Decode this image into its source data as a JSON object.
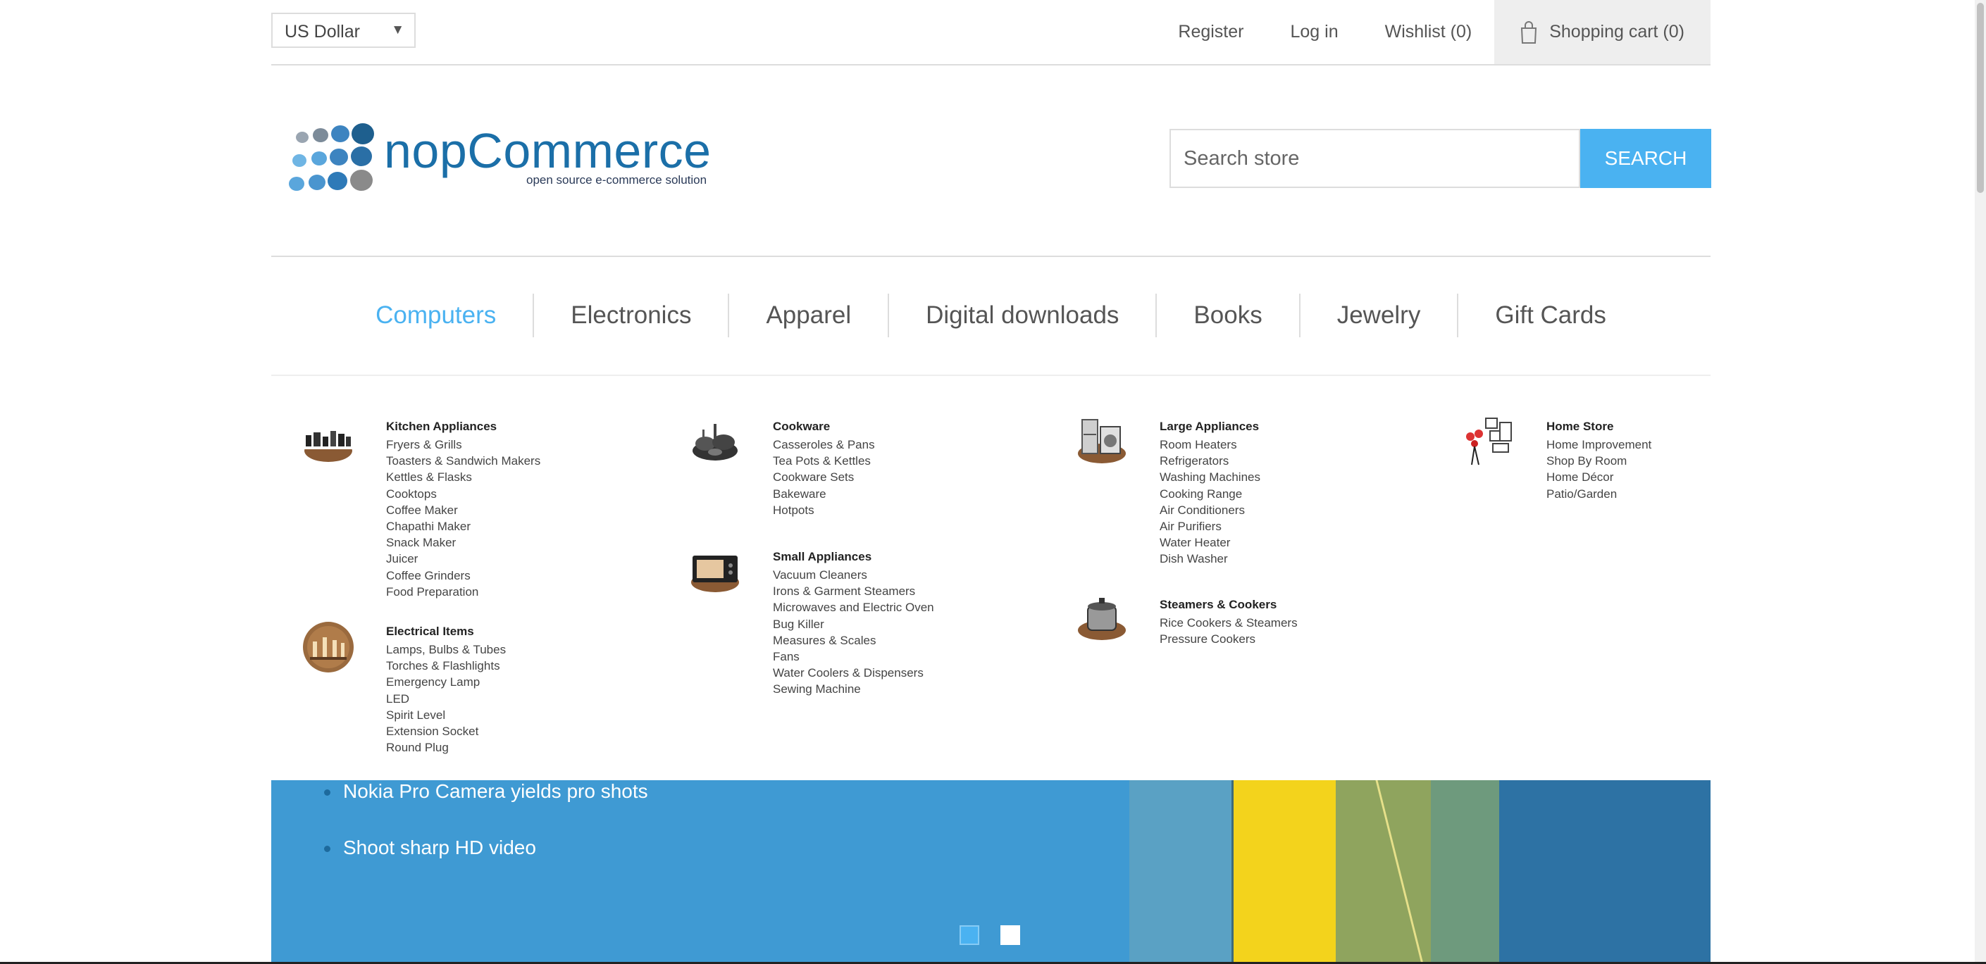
{
  "header": {
    "currency": "US Dollar",
    "links": {
      "register": "Register",
      "login": "Log in",
      "wishlist": "Wishlist (0)",
      "cart": "Shopping cart (0)"
    }
  },
  "logo": {
    "word": "nopCommerce",
    "tagline": "open source e-commerce solution"
  },
  "search": {
    "placeholder": "Search store",
    "button": "SEARCH"
  },
  "menu": {
    "items": [
      {
        "label": "Computers",
        "active": true
      },
      {
        "label": "Electronics"
      },
      {
        "label": "Apparel"
      },
      {
        "label": "Digital downloads"
      },
      {
        "label": "Books"
      },
      {
        "label": "Jewelry"
      },
      {
        "label": "Gift Cards"
      }
    ]
  },
  "mega": {
    "kitchen": {
      "title": "Kitchen Appliances",
      "items": [
        "Fryers & Grills",
        "Toasters & Sandwich Makers",
        "Kettles & Flasks",
        "Cooktops",
        "Coffee Maker",
        "Chapathi Maker",
        "Snack Maker",
        "Juicer",
        "Coffee Grinders",
        "Food Preparation"
      ]
    },
    "electrical": {
      "title": "Electrical Items",
      "items": [
        "Lamps, Bulbs & Tubes",
        "Torches & Flashlights",
        "Emergency Lamp",
        "LED",
        "Spirit Level",
        "Extension Socket",
        "Round Plug"
      ]
    },
    "cookware": {
      "title": "Cookware",
      "items": [
        "Casseroles & Pans",
        "Tea Pots & Kettles",
        "Cookware Sets",
        "Bakeware",
        "Hotpots"
      ]
    },
    "small": {
      "title": "Small Appliances",
      "items": [
        "Vacuum Cleaners",
        "Irons & Garment Steamers",
        "Microwaves and Electric Oven",
        "Bug Killer",
        "Measures & Scales",
        "Fans",
        "Water Coolers & Dispensers",
        "Sewing Machine"
      ]
    },
    "large": {
      "title": "Large Appliances",
      "items": [
        "Room Heaters",
        "Refrigerators",
        "Washing Machines",
        "Cooking Range",
        "Air Conditioners",
        "Air Purifiers",
        "Water Heater",
        "Dish Washer"
      ]
    },
    "steamers": {
      "title": "Steamers & Cookers",
      "items": [
        "Rice Cookers & Steamers",
        "Pressure Cookers"
      ]
    },
    "home": {
      "title": "Home Store",
      "items": [
        "Home Improvement",
        "Shop By Room",
        "Home Décor",
        "Patio/Garden"
      ]
    }
  },
  "slider": {
    "bullets": [
      "Nokia Pro Camera yields pro shots",
      "Shoot sharp HD video"
    ]
  },
  "colors": {
    "accent": "#4ab2f1",
    "slider_bg": "#3f9ad3"
  }
}
